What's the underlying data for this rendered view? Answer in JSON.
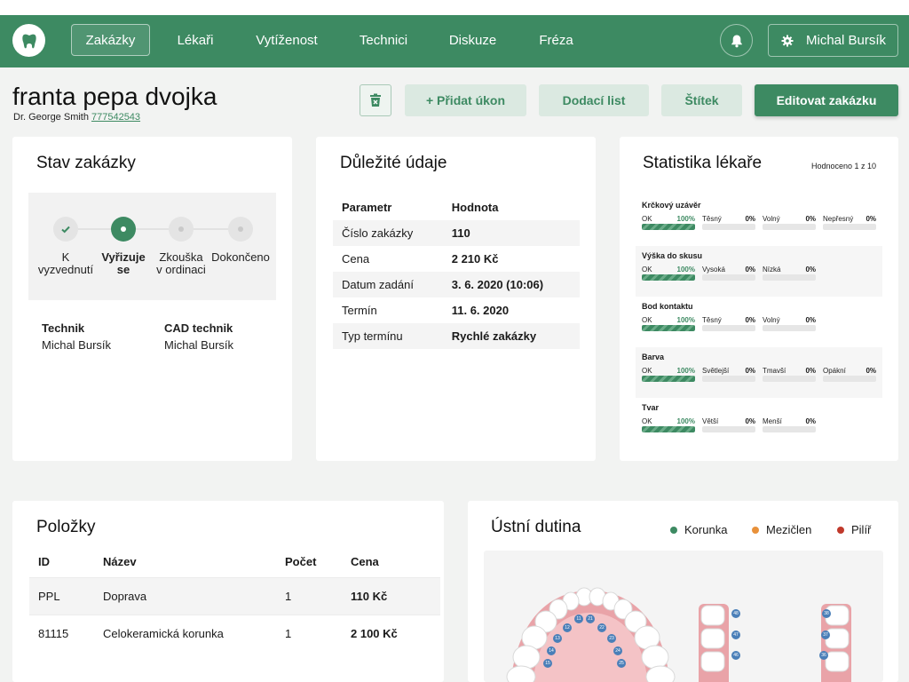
{
  "nav": {
    "logo_icon": "tooth-icon",
    "items": [
      "Zakázky",
      "Lékaři",
      "Vytíženost",
      "Technici",
      "Diskuze",
      "Fréza"
    ],
    "active": "Zakázky",
    "user": "Michal Bursík"
  },
  "page": {
    "title": "franta pepa dvojka",
    "doctor": "Dr. George Smith",
    "phone": "777542543",
    "buttons": {
      "delete_icon": "trash-icon",
      "add": "+ Přidat úkon",
      "delivery": "Dodací list",
      "label": "Štítek",
      "edit": "Editovat zakázku"
    }
  },
  "status": {
    "title": "Stav zakázky",
    "steps": [
      {
        "l1": "K",
        "l2": "vyzvednutí",
        "state": "done"
      },
      {
        "l1": "Vyřizuje",
        "l2": "se",
        "state": "current"
      },
      {
        "l1": "Zkouška",
        "l2": "v ordinaci",
        "state": "todo"
      },
      {
        "l1": "Dokončeno",
        "l2": "",
        "state": "todo"
      }
    ],
    "technik_label": "Technik",
    "technik": "Michal Bursík",
    "cad_label": "CAD technik",
    "cad": "Michal Bursík"
  },
  "key": {
    "title": "Důležité údaje",
    "col1": "Parametr",
    "col2": "Hodnota",
    "rows": [
      {
        "k": "Číslo zakázky",
        "v": "110"
      },
      {
        "k": "Cena",
        "v": "2 210 Kč"
      },
      {
        "k": "Datum zadání",
        "v": "3. 6. 2020 (10:06)"
      },
      {
        "k": "Termín",
        "v": "11. 6. 2020"
      },
      {
        "k": "Typ termínu",
        "v": "Rychlé zakázky"
      }
    ]
  },
  "stats": {
    "title": "Statistika lékaře",
    "rated": "Hodnoceno 1 z 10",
    "groups": [
      {
        "name": "Krčkový uzávěr",
        "items": [
          {
            "l": "OK",
            "p": "100%"
          },
          {
            "l": "Těsný",
            "p": "0%"
          },
          {
            "l": "Volný",
            "p": "0%"
          },
          {
            "l": "Nepřesný",
            "p": "0%"
          }
        ]
      },
      {
        "name": "Výška do skusu",
        "items": [
          {
            "l": "OK",
            "p": "100%"
          },
          {
            "l": "Vysoká",
            "p": "0%"
          },
          {
            "l": "Nízká",
            "p": "0%"
          }
        ]
      },
      {
        "name": "Bod kontaktu",
        "items": [
          {
            "l": "OK",
            "p": "100%"
          },
          {
            "l": "Těsný",
            "p": "0%"
          },
          {
            "l": "Volný",
            "p": "0%"
          }
        ]
      },
      {
        "name": "Barva",
        "items": [
          {
            "l": "OK",
            "p": "100%"
          },
          {
            "l": "Světlejší",
            "p": "0%"
          },
          {
            "l": "Tmavší",
            "p": "0%"
          },
          {
            "l": "Opákní",
            "p": "0%"
          }
        ]
      },
      {
        "name": "Tvar",
        "items": [
          {
            "l": "OK",
            "p": "100%"
          },
          {
            "l": "Větší",
            "p": "0%"
          },
          {
            "l": "Menší",
            "p": "0%"
          }
        ]
      }
    ]
  },
  "items": {
    "title": "Položky",
    "cols": [
      "ID",
      "Název",
      "Počet",
      "Cena"
    ],
    "rows": [
      {
        "id": "PPL",
        "name": "Doprava",
        "count": "1",
        "price": "110 Kč"
      },
      {
        "id": "81115",
        "name": "Celokeramická korunka",
        "count": "1",
        "price": "2 100 Kč"
      }
    ]
  },
  "mouth": {
    "title": "Ústní dutina",
    "legend": [
      {
        "label": "Korunka",
        "color": "#3d8a62"
      },
      {
        "label": "Mezičlen",
        "color": "#e8913a"
      },
      {
        "label": "Pilíř",
        "color": "#c0392b"
      }
    ],
    "teeth_upper": [
      "11",
      "21",
      "12",
      "22",
      "13",
      "23",
      "14",
      "24",
      "15",
      "25"
    ],
    "teeth_side_left": [
      "48",
      "47",
      "46"
    ],
    "teeth_side_right": [
      "38",
      "37",
      "36"
    ]
  },
  "colors": {
    "primary": "#3d8a62",
    "primary_light": "#dbe9e1",
    "background": "#f2f3f2"
  }
}
